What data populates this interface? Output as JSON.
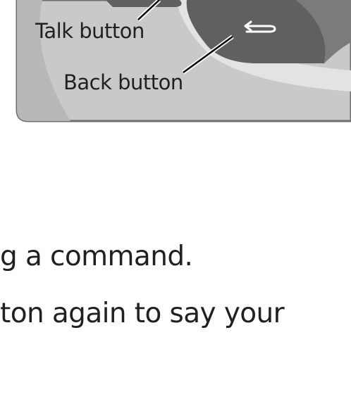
{
  "figure": {
    "callouts": {
      "talk_label": "Talk button",
      "back_label": "Back button"
    },
    "icons": {
      "back_button_icon": "return-arrow-icon"
    },
    "colors": {
      "panel_fill": "#c9c9ca",
      "panel_border": "#6d6e70",
      "button_dark": "#5f6062",
      "panel_light": "#e3e3e4"
    }
  },
  "text": {
    "line_1": "g a command.",
    "line_2": "ton again to say your"
  }
}
